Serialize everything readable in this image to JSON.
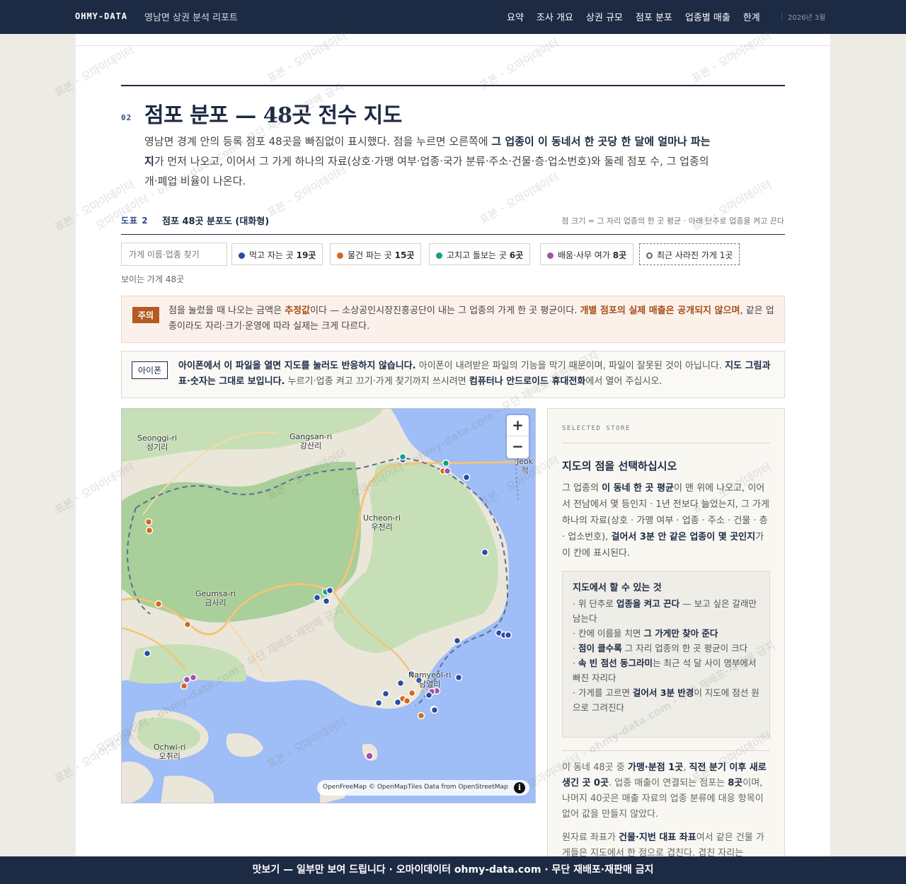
{
  "nav": {
    "brand": "OHMY-DATA",
    "report_title": "영남면 상권 분석 리포트",
    "links": [
      "요약",
      "조사 개요",
      "상권 규모",
      "점포 분포",
      "업종별 매출",
      "한계"
    ],
    "date": "2026년 3월"
  },
  "section": {
    "number": "02",
    "title": "점포 분포 — 48곳 전수 지도",
    "lede_1": "영남면 경계 안의 등록 점포 48곳을 빠짐없이 표시했다. 점을 누르면 오른쪽에 ",
    "lede_bold": "그 업종이 이 동네서 한 곳당 한 달에 얼마나 파는지",
    "lede_2": "가 먼저 나오고, 이어서 그 가게 하나의 자료(상호·가맹 여부·업종·국가 분류·주소·건물·층·업소번호)와 둘레 점포 수, 그 업종의 개·폐업 비율이 나온다."
  },
  "figure": {
    "label": "도표 2",
    "title": "점포 48곳 분포도 (대화형)",
    "note": "점 크기 = 그 자리 업종의 한 곳 평균 · 아래 단추로 업종을 켜고 끈다",
    "search_placeholder": "가게 이름·업종 찾기",
    "visible_count": "보이는 가게 48곳",
    "filters": [
      {
        "label": "먹고 자는 곳",
        "count": "19곳",
        "color": "#2b4aa8"
      },
      {
        "label": "물건 파는 곳",
        "count": "15곳",
        "color": "#d2691e"
      },
      {
        "label": "고치고 돌보는 곳",
        "count": "6곳",
        "color": "#16a085"
      },
      {
        "label": "배움·사무 여가",
        "count": "8곳",
        "color": "#a552a8"
      },
      {
        "label": "최근 사라진 가게",
        "count": "1곳",
        "color": "#666666"
      }
    ]
  },
  "warning": {
    "tag": "주의",
    "t1": "점을 눌렀을 때 나오는 금액은 ",
    "b1": "추정값",
    "t2": "이다 — 소상공인시장진흥공단이 내는 그 업종의 가게 한 곳 평균이다. ",
    "b2": "개별 점포의 실제 매출은 공개되지 않으며",
    "t3": ", 같은 업종이라도 자리·크기·운영에 따라 실제는 크게 다르다."
  },
  "iphone": {
    "tag": "아이폰",
    "b1": "아이폰에서 이 파일을 열면 지도를 눌러도 반응하지 않습니다.",
    "t1": " 아이폰이 내려받은 파일의 기능을 막기 때문이며, 파일이 잘못된 것이 아닙니다. ",
    "b2": "지도 그림과 표·숫자는 그대로 보입니다.",
    "t2": " 누르기·업종 켜고 끄기·가게 찾기까지 쓰시려면 ",
    "b3": "컴퓨터나 안드로이드 휴대전화",
    "t3": "에서 열어 주십시오."
  },
  "map": {
    "places": [
      {
        "en": "Seonggi-ri",
        "ko": "성기리"
      },
      {
        "en": "Gangsan-ri",
        "ko": "강산리"
      },
      {
        "en": "Jeok",
        "ko": "적"
      },
      {
        "en": "Ucheon-ri",
        "ko": "우천리"
      },
      {
        "en": "Geumsa-ri",
        "ko": "금사리"
      },
      {
        "en": "Namyeol-ri",
        "ko": "남열리"
      },
      {
        "en": "Ochwi-ri",
        "ko": "오취리"
      }
    ],
    "zoom_in": "+",
    "zoom_out": "−",
    "attribution": "OpenFreeMap © OpenMapTiles Data from OpenStreetMap",
    "info": "i",
    "colors": {
      "food": "#2b4aa8",
      "retail": "#d2691e",
      "service": "#16a085",
      "edu": "#a552a8"
    }
  },
  "side": {
    "kicker": "SELECTED STORE",
    "title": "지도의 점을 선택하십시오",
    "d1": "그 업종의 ",
    "db1": "이 동네 한 곳 평균",
    "d2": "이 맨 위에 나오고, 이어서 전남에서 몇 등인지 · 1년 전보다 늘었는지, 그 가게 하나의 자료(상호 · 가맹 여부 · 업종 · 주소 · 건물 · 층 · 업소번호), ",
    "db2": "걸어서 3분 안 같은 업종이 몇 곳인지",
    "d3": "가 이 칸에 표시된다.",
    "howto_title": "지도에서 할 수 있는 것",
    "h1a": "· 위 단추로 ",
    "h1b": "업종을 켜고 끈다",
    "h1c": " — 보고 싶은 갈래만 남는다",
    "h2a": "· 칸에 이름을 치면 ",
    "h2b": "그 가게만 찾아 준다",
    "h3a": "· ",
    "h3b": "점이 클수록",
    "h3c": " 그 자리 업종의 한 곳 평균이 크다",
    "h4a": "· ",
    "h4b": "속 빈 점선 동그라미",
    "h4c": "는 최근 석 달 사이 명부에서 빠진 자리다",
    "h5a": "· 가게를 고르면 ",
    "h5b": "걸어서 3분 반경",
    "h5c": "이 지도에 점선 원으로 그려진다",
    "s1": "이 동네 48곳 중 ",
    "sb1": "가맹·분점 1곳",
    "s2": ", ",
    "sb2": "직전 분기 이후 새로 생긴 곳 0곳",
    "s3": ". 업종 매출이 연결되는 점포는 ",
    "sb3": "8곳",
    "s4": "이며, 나머지 40곳은 매출 자료의 업종 분류에 대응 항목이 없어 값을 만들지 않았다.",
    "c1": "원자료 좌표가 ",
    "cb1": "건물·지번 대표 좌표",
    "c2": "여서 같은 건물 가게들은 지도에서 한 점으로 겹친다. 겹친 자리는"
  },
  "watermark": "표본 · 오마이데이터",
  "watermark2": "오마이데이터 · ohmy-data.com · 무단 재배포·재판매 금지",
  "footer": "맛보기 — 일부만 보여 드립니다 · 오마이데이터 ohmy-data.com · 무단 재배포·재판매 금지"
}
